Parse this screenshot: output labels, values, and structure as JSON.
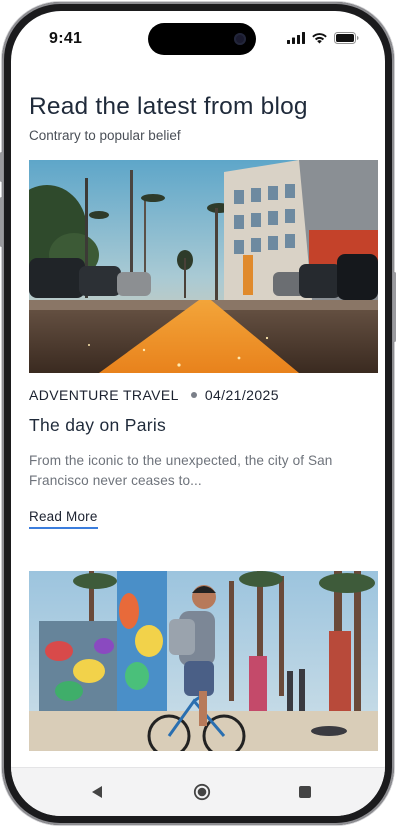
{
  "status_bar": {
    "time": "9:41",
    "icons": [
      "cellular-signal-icon",
      "wifi-icon",
      "battery-icon"
    ]
  },
  "blog": {
    "title": "Read the latest from blog",
    "subtitle": "Contrary to popular belief"
  },
  "posts": [
    {
      "category": "ADVENTURE TRAVEL",
      "date": "04/21/2025",
      "title": "The day on Paris",
      "excerpt": "From the iconic to the unexpected, the city of San Francisco never ceases to...",
      "read_more_label": "Read More",
      "image": "street-road-sunset-photo"
    },
    {
      "image": "cyclist-graffiti-beach-photo"
    }
  ],
  "nav_bar": {
    "buttons": [
      "back-icon",
      "home-icon",
      "recents-icon"
    ]
  },
  "colors": {
    "heading": "#1f2a3a",
    "body_text": "#6e737b",
    "link_underline": "#3b7ddd",
    "background": "#ffffff"
  }
}
